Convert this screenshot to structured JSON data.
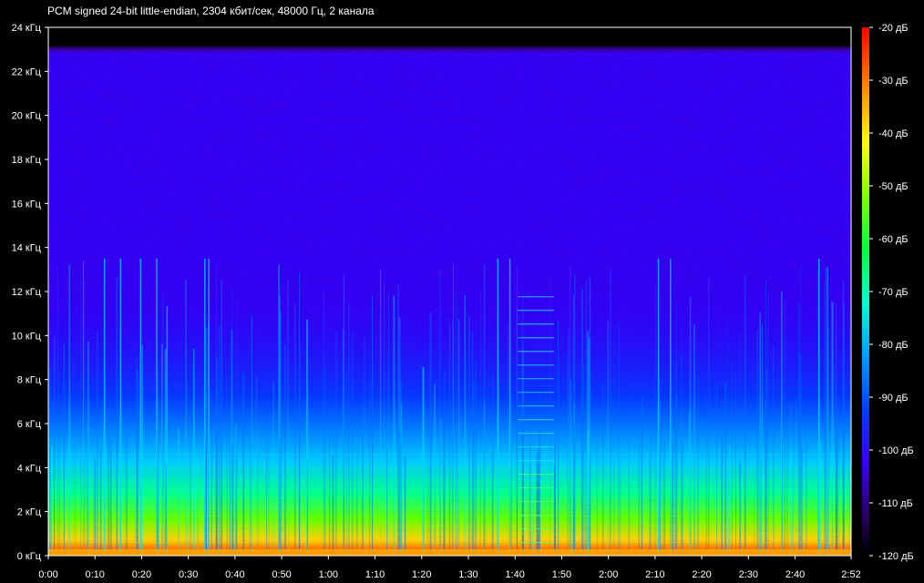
{
  "title": "PCM signed 24-bit little-endian, 2304 кбит/сек, 48000 Гц, 2 канала",
  "chart_data": {
    "type": "heatmap",
    "title": "PCM signed 24-bit little-endian, 2304 кбит/сек, 48000 Гц, 2 канала",
    "x_axis": {
      "unit": "time",
      "range": [
        "0:00",
        "2:52"
      ],
      "ticks": [
        "0:00",
        "0:10",
        "0:20",
        "0:30",
        "0:40",
        "0:50",
        "1:00",
        "1:10",
        "1:20",
        "1:30",
        "1:40",
        "1:50",
        "2:00",
        "2:10",
        "2:20",
        "2:30",
        "2:40",
        "2:52"
      ]
    },
    "y_axis": {
      "unit": "кГц",
      "range": [
        0,
        24
      ],
      "ticks": [
        "0 кГц",
        "2 кГц",
        "4 кГц",
        "6 кГц",
        "8 кГц",
        "10 кГц",
        "12 кГц",
        "14 кГц",
        "16 кГц",
        "18 кГц",
        "20 кГц",
        "22 кГц",
        "24 кГц"
      ]
    },
    "colorbar": {
      "unit": "дБ",
      "range": [
        -120,
        -20
      ],
      "ticks": [
        "-20 дБ",
        "-30 дБ",
        "-40 дБ",
        "-50 дБ",
        "-60 дБ",
        "-70 дБ",
        "-80 дБ",
        "-90 дБ",
        "-100 дБ",
        "-110 дБ",
        "-120 дБ"
      ],
      "colors": [
        "#000000",
        "#1a0033",
        "#3a00a0",
        "#0000ff",
        "#0066ff",
        "#00d0ff",
        "#00ff90",
        "#40ff00",
        "#d0ff00",
        "#ffd000",
        "#ff7000",
        "#ff0000"
      ]
    },
    "cutoff_khz": 23,
    "background_level_db": -105
  }
}
